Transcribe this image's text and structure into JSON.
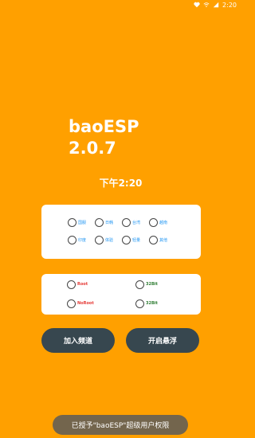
{
  "status_bar": {
    "icons": [
      "heart-icon",
      "wifi-icon",
      "signal-icon"
    ],
    "time": "2:20"
  },
  "app": {
    "title_line1": "baoESP",
    "title_line2": "2.0.7"
  },
  "clock": "下午2:20",
  "region_options": [
    {
      "label": "国服"
    },
    {
      "label": "日韩"
    },
    {
      "label": "台湾"
    },
    {
      "label": "越南"
    },
    {
      "label": "印度"
    },
    {
      "label": "体验"
    },
    {
      "label": "轻量"
    },
    {
      "label": "其他"
    }
  ],
  "mode_options": [
    {
      "label": "Root"
    },
    {
      "label": "32Bit"
    },
    {
      "label": "NoRoot"
    },
    {
      "label": "32Bit"
    }
  ],
  "buttons": {
    "join_channel": "加入频道",
    "start_float": "开启悬浮"
  },
  "toast": "已授予\"baoESP\"超级用户权限",
  "colors": {
    "background": "#FFA000",
    "button": "#37474F",
    "red_label": "#E53935",
    "green_label": "#2E7D32",
    "blue_label": "#2196F3"
  }
}
